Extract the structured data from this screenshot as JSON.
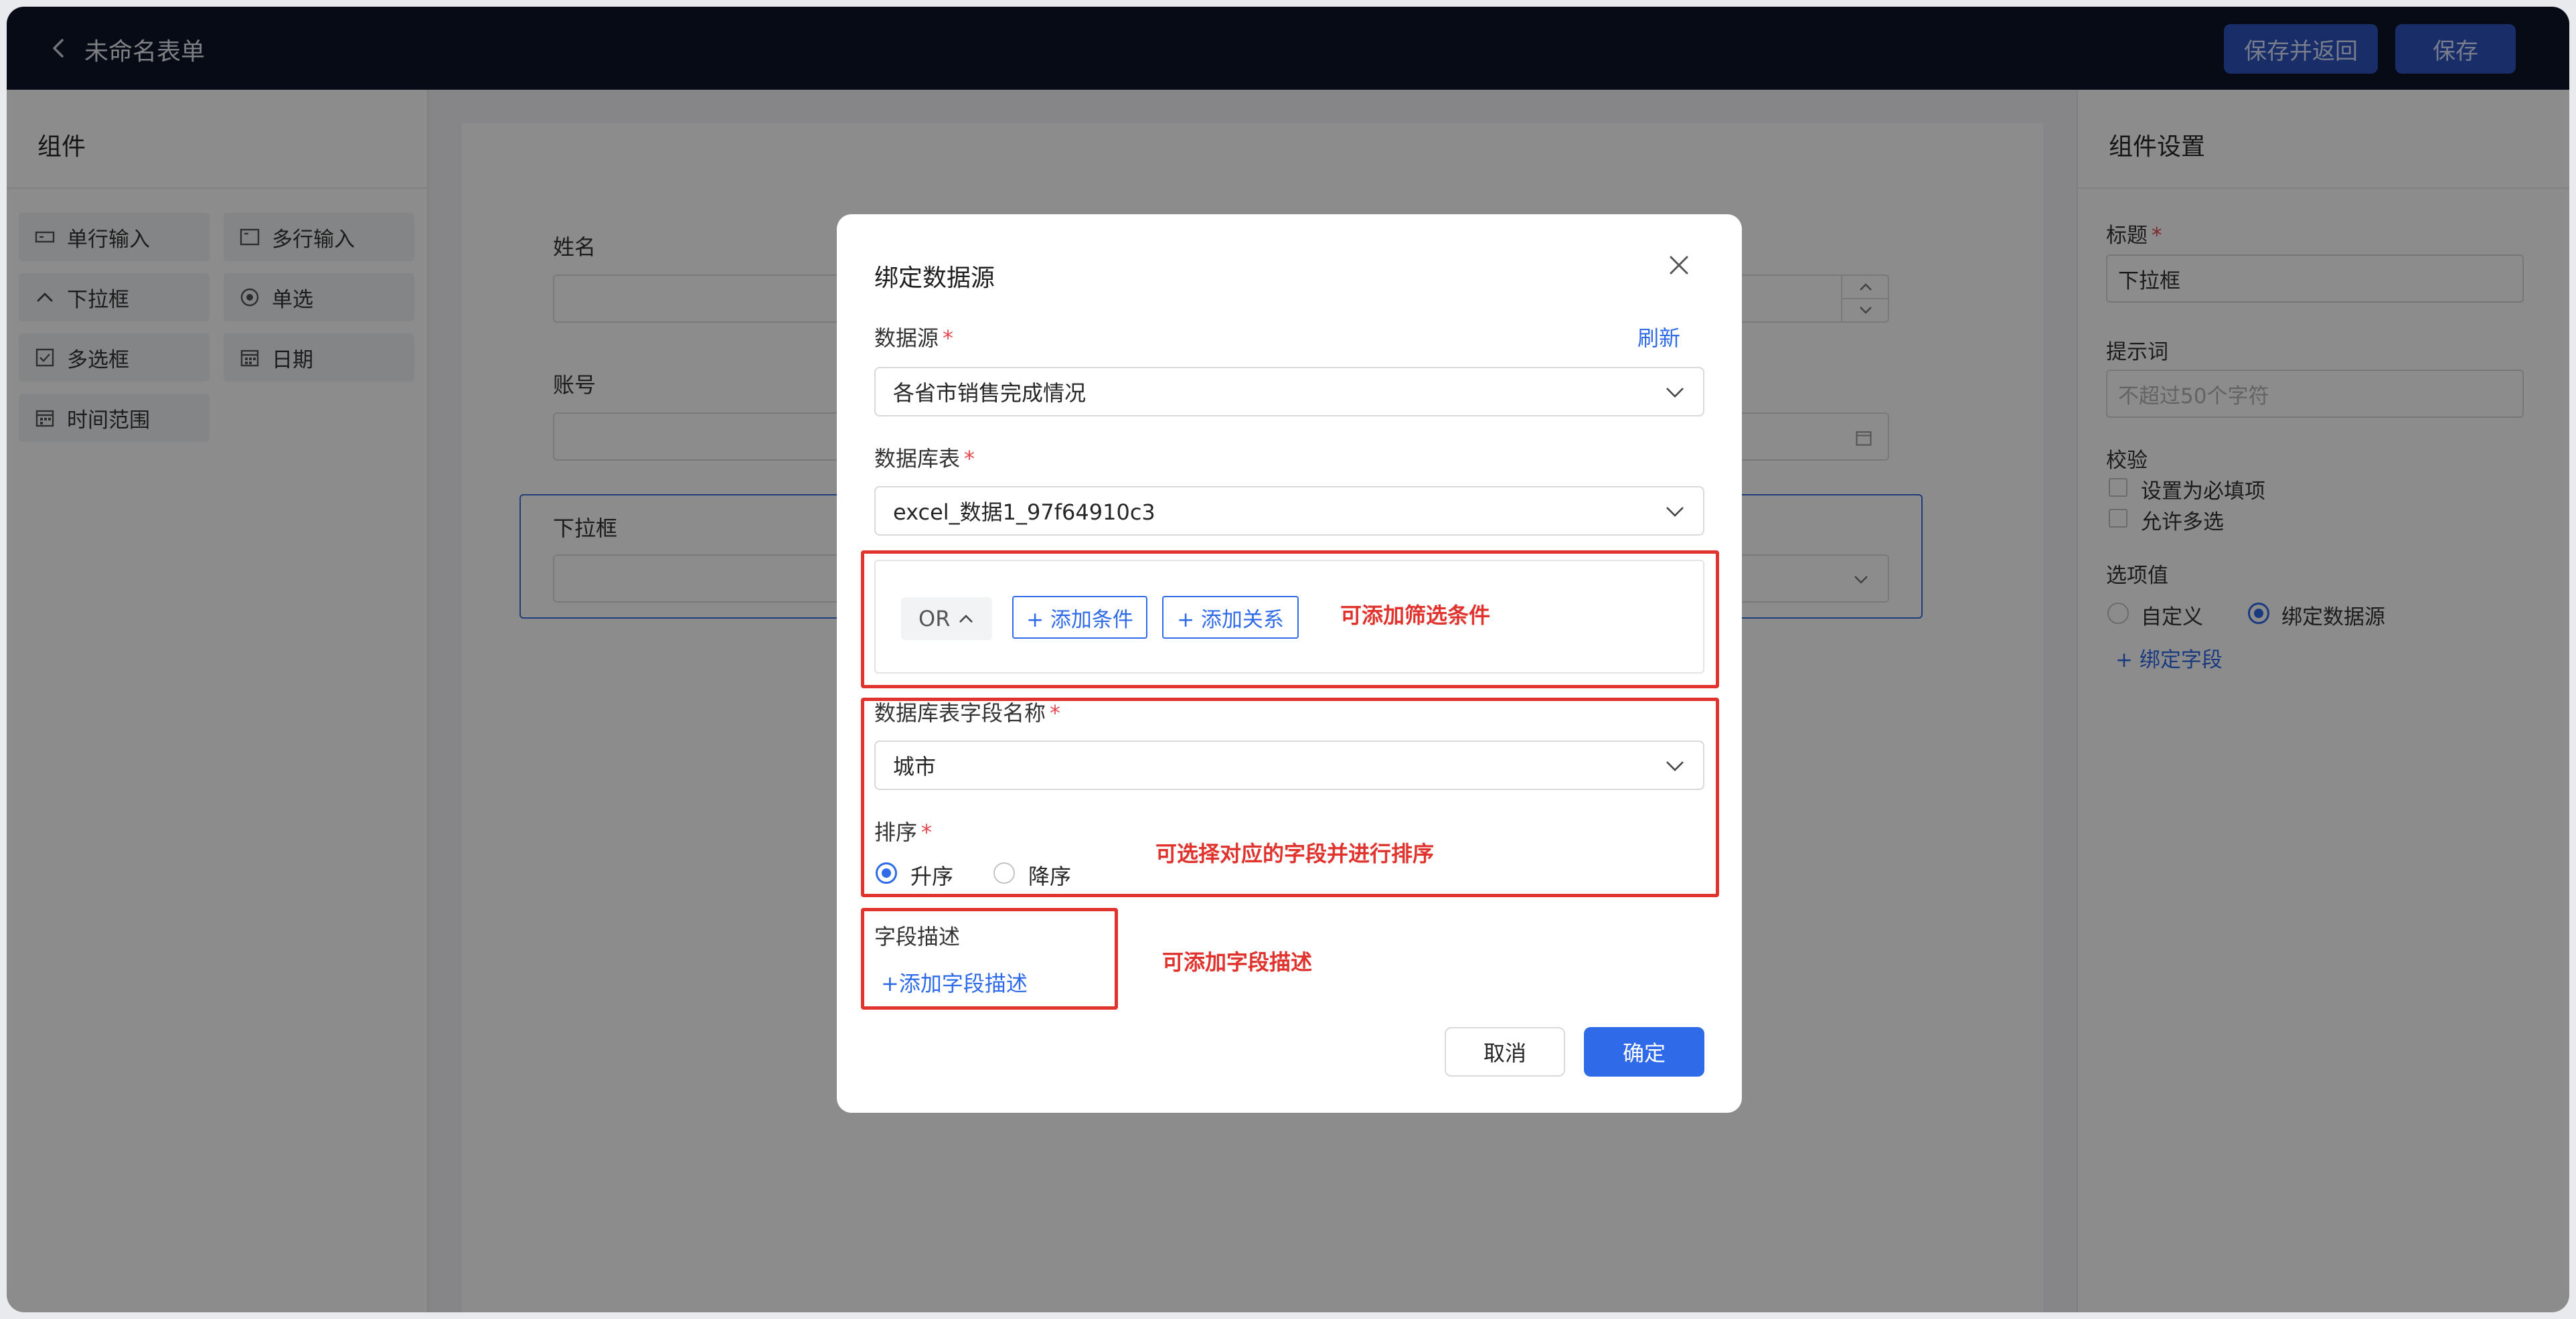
{
  "header": {
    "title": "未命名表单",
    "save_return_label": "保存并返回",
    "save_label": "保存"
  },
  "components_panel": {
    "title": "组件",
    "items": [
      {
        "label": "单行输入",
        "icon": "single-line-input-icon"
      },
      {
        "label": "多行输入",
        "icon": "multi-line-input-icon"
      },
      {
        "label": "下拉框",
        "icon": "chevron-up-icon"
      },
      {
        "label": "单选",
        "icon": "radio-icon"
      },
      {
        "label": "多选框",
        "icon": "checkbox-icon"
      },
      {
        "label": "日期",
        "icon": "calendar-icon"
      },
      {
        "label": "时间范围",
        "icon": "time-range-icon"
      }
    ]
  },
  "form_canvas": {
    "fields": [
      {
        "label": "姓名"
      },
      {
        "label": "账号"
      },
      {
        "label": "下拉框"
      }
    ]
  },
  "settings_panel": {
    "title": "组件设置",
    "title_label": "标题",
    "title_required": "*",
    "title_value": "下拉框",
    "hint_label": "提示词",
    "hint_placeholder": "不超过50个字符",
    "validation_label": "校验",
    "required_option": "设置为必填项",
    "multi_option": "允许多选",
    "options_label": "选项值",
    "custom_option": "自定义",
    "datasource_option": "绑定数据源",
    "selected_option": "绑定数据源",
    "bind_field_link": "+ 绑定字段"
  },
  "modal": {
    "title": "绑定数据源",
    "datasource_label": "数据源",
    "required_mark": "*",
    "refresh_link": "刷新",
    "datasource_value": "各省市销售完成情况",
    "table_label": "数据库表",
    "table_value": "excel_数据1_97f64910c3",
    "logic_value": "OR",
    "add_condition": "+ 添加条件",
    "add_relation": "+ 添加关系",
    "field_label": "数据库表字段名称",
    "field_value": "城市",
    "sort_label": "排序",
    "sort_asc": "升序",
    "sort_desc": "降序",
    "sort_selected": "升序",
    "desc_label": "字段描述",
    "add_desc_link": "+添加字段描述",
    "cancel_label": "取消",
    "ok_label": "确定"
  },
  "annotations": {
    "filter": "可添加筛选条件",
    "sort": "可选择对应的字段并进行排序",
    "desc": "可添加字段描述"
  },
  "colors": {
    "topbar": "#0c1527",
    "primary": "#2f6ae8",
    "annotation_red": "#e0332e",
    "overlay": "rgba(0,0,0,0.45)"
  }
}
